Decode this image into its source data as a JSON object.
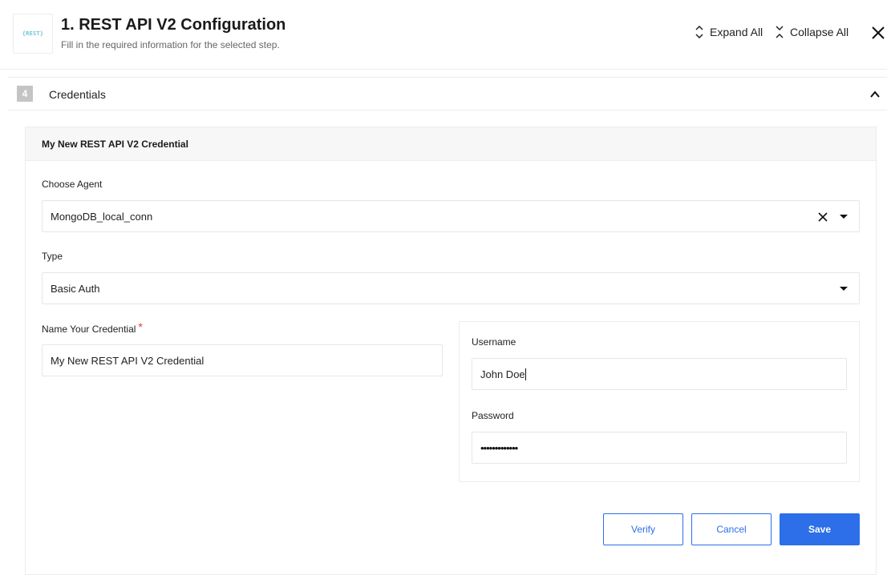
{
  "header": {
    "logo_text": "{REST}",
    "title": "1. REST API V2 Configuration",
    "subtitle": "Fill in the required information for the selected step.",
    "expand_all_label": "Expand All",
    "collapse_all_label": "Collapse All"
  },
  "section": {
    "step_number": "4",
    "label": "Credentials",
    "expanded": true
  },
  "credential_card": {
    "title": "My New REST API V2 Credential",
    "choose_agent": {
      "label": "Choose Agent",
      "value": "MongoDB_local_conn"
    },
    "type": {
      "label": "Type",
      "value": "Basic Auth"
    },
    "name": {
      "label": "Name Your Credential",
      "required_marker": "*",
      "value": "My New REST API V2 Credential"
    },
    "username": {
      "label": "Username",
      "value": "John Doe"
    },
    "password": {
      "label": "Password",
      "masked_value": "•••••••••••••"
    },
    "buttons": {
      "verify": "Verify",
      "cancel": "Cancel",
      "save": "Save"
    }
  },
  "colors": {
    "primary": "#2c6fe8",
    "required": "#e53935",
    "logo": "#6cc3d5"
  }
}
